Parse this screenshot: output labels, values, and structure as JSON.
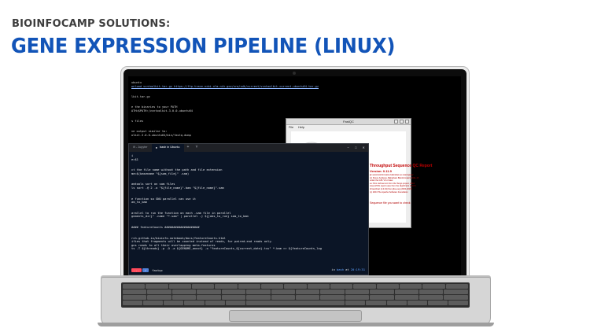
{
  "header": {
    "kicker": "BIOINFOCAMP SOLUTIONS:",
    "title": "GENE EXPRESSION PIPELINE (LINUX)"
  },
  "background_terminal": {
    "lines": [
      "ubuntu",
      "wnload vcntoolkit.tar.gz https://ftp-trace.ncbi.nlm.nih.gov/sra/sdk/current/vcntoolkit-current-ubuntu64.tar.gz",
      "",
      "lkit.tar.gz",
      "",
      "e the binaries to your PATH",
      "ATH=$PATH:/vcntoolkit-3.0.0-ubuntu64",
      "",
      "s files",
      "",
      "ve output similar to:",
      "olkit-3.0.0-ubuntu64/bin/fastq-dump"
    ],
    "link_line_index": 1
  },
  "fastqc": {
    "window_title": "FastQC",
    "menu": [
      "File",
      "Help"
    ],
    "heading": "Throughput Sequence QC Report",
    "version": "Version: 0.11.9",
    "info_lines": [
      "@ www.bioinformatics.babraham.ac.uk/projects/",
      "(c) Simon Andrews, Babraham Bioinformatics 2011-17,",
      "under the GPL V3 or later.",
      "es: Pico Jerboa icon from the Tango project, 2010",
      "Java HTML report uses from the Highcharts (5.0.7)",
      "JFreeChart (1.0.19) from jfree.org (2000-2015)",
      "(c) 2004 The Apache Software Foundation"
    ],
    "choose_text": "Sequence file you want to check"
  },
  "terminal": {
    "tabs": [
      {
        "label": "ifi - Jupyter",
        "active": false
      },
      {
        "label": "bash in Ubuntu",
        "active": true
      }
    ],
    "tab_add": "+",
    "tab_menu": "˅",
    "window_controls": [
      "−",
      "□",
      "✕"
    ],
    "lines": [
      "i",
      "e=$1",
      "",
      "ct the file name without the path and file extension",
      "me=$(basename \"${sam_file}\" .sam)",
      "",
      "amtools sort on sam files",
      "ls sort -@ 2 -o \"${file_name}\".bam \"${file_name}\".sam",
      "",
      "e function so GNU parallel can use it",
      "am_to_bam",
      "",
      "arallel to run the function on each .sam file in parallel",
      "gnments_dir}\" -name \"*.sam\" | parallel -j ${jobs_to_run} sam_to_bam",
      "",
      "#### featureCounts ####################",
      "",
      "rch.github.io/bioinfo-notebook/docs/featureCounts.html",
      "ifies that fragments will be counted instead of reads, for paired-end reads only.",
      "gns reads to all their overlapping meta-features",
      "ts -T ${threads} -p -O -a ${GENOME_annot} -o \"featureCounts_${current_date}.tsv\" *.bam >> ${featureCounts_log"
    ],
    "status": {
      "segment_left": "...",
      "segment_mid": "✓",
      "prompt": "fastqc",
      "right_dir_prefix": "in",
      "right_dir": "bash",
      "right_at": "at",
      "right_time": "20:19:31"
    }
  },
  "colors": {
    "headline": "#1254b8",
    "kicker": "#3d3d3d",
    "fastqc_red": "#c10000",
    "terminal_bg": "#0b1526",
    "powerline_red": "#ff4a5b",
    "powerline_blue": "#4f7fd6"
  }
}
